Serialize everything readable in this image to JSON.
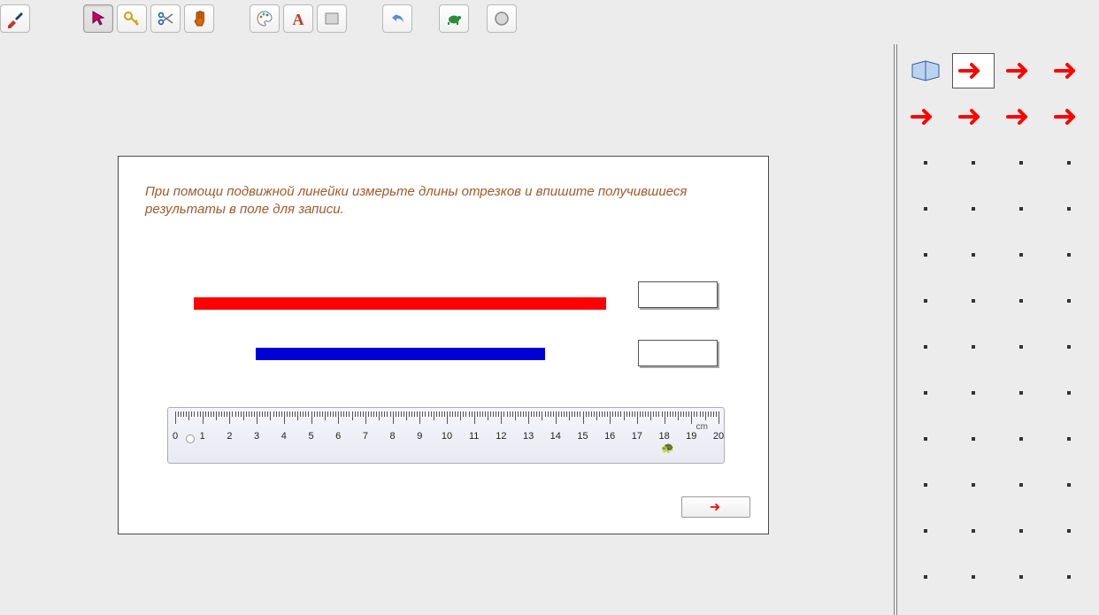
{
  "toolbar": {
    "groups": [
      [
        {
          "name": "brush-icon"
        }
      ],
      [
        {
          "name": "pointer-icon",
          "active": true
        },
        {
          "name": "key-icon"
        },
        {
          "name": "scissors-icon"
        },
        {
          "name": "hand-icon"
        }
      ],
      [
        {
          "name": "palette-icon"
        },
        {
          "name": "text-A-icon"
        },
        {
          "name": "rect-icon"
        }
      ],
      [
        {
          "name": "undo-icon"
        }
      ],
      [
        {
          "name": "turtle-icon"
        }
      ],
      [
        {
          "name": "circle-icon"
        }
      ]
    ]
  },
  "worksheet": {
    "instruction": "При помощи подвижной линейки измерьте длины отрезков и впишите получившиеся результаты в поле для записи.",
    "answer1": "",
    "answer2": "",
    "ruler": {
      "unit_label": "cm",
      "min": 0,
      "max": 20,
      "labels": [
        "0",
        "1",
        "2",
        "3",
        "4",
        "5",
        "6",
        "7",
        "8",
        "9",
        "10",
        "11",
        "12",
        "13",
        "14",
        "15",
        "16",
        "17",
        "18",
        "19",
        "20"
      ]
    },
    "next_label": "→"
  },
  "sidebar": {
    "thumbs": [
      {
        "kind": "book"
      },
      {
        "kind": "arrow",
        "current": true
      },
      {
        "kind": "arrow"
      },
      {
        "kind": "arrow"
      },
      {
        "kind": "arrow"
      },
      {
        "kind": "arrow"
      },
      {
        "kind": "arrow"
      },
      {
        "kind": "arrow"
      },
      {
        "kind": "dot"
      },
      {
        "kind": "dot"
      },
      {
        "kind": "dot"
      },
      {
        "kind": "dot"
      },
      {
        "kind": "dot"
      },
      {
        "kind": "dot"
      },
      {
        "kind": "dot"
      },
      {
        "kind": "dot"
      },
      {
        "kind": "dot"
      },
      {
        "kind": "dot"
      },
      {
        "kind": "dot"
      },
      {
        "kind": "dot"
      },
      {
        "kind": "dot"
      },
      {
        "kind": "dot"
      },
      {
        "kind": "dot"
      },
      {
        "kind": "dot"
      },
      {
        "kind": "dot"
      },
      {
        "kind": "dot"
      },
      {
        "kind": "dot"
      },
      {
        "kind": "dot"
      },
      {
        "kind": "dot"
      },
      {
        "kind": "dot"
      },
      {
        "kind": "dot"
      },
      {
        "kind": "dot"
      },
      {
        "kind": "dot"
      },
      {
        "kind": "dot"
      },
      {
        "kind": "dot"
      },
      {
        "kind": "dot"
      },
      {
        "kind": "dot"
      },
      {
        "kind": "dot"
      },
      {
        "kind": "dot"
      },
      {
        "kind": "dot"
      },
      {
        "kind": "dot"
      },
      {
        "kind": "dot"
      },
      {
        "kind": "dot"
      },
      {
        "kind": "dot"
      },
      {
        "kind": "dot"
      },
      {
        "kind": "dot"
      },
      {
        "kind": "dot"
      },
      {
        "kind": "dot"
      }
    ]
  }
}
